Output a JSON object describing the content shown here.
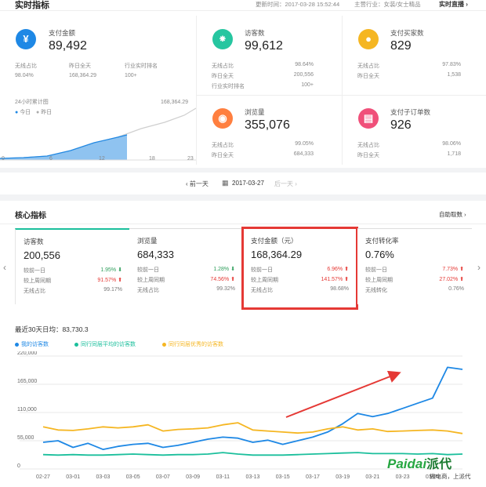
{
  "header": {
    "title": "实时指标",
    "updated": "更新时间：2017-03-28 15:52:44",
    "industry": "主营行业：女装/女士精品",
    "live_link": "实时直播"
  },
  "kpis": {
    "pay_amount": {
      "title": "支付金额",
      "value": "89,492",
      "labels": [
        "无线占比",
        "昨日全天",
        "行业实时排名"
      ],
      "values": [
        "98.04%",
        "168,364.29",
        "100+"
      ]
    },
    "visitors": {
      "title": "访客数",
      "value": "99,612",
      "labels": [
        "无线占比",
        "昨日全天",
        "行业实时排名"
      ],
      "values": [
        "98.64%",
        "200,556",
        "100+"
      ]
    },
    "buyers": {
      "title": "支付买家数",
      "value": "829",
      "labels": [
        "无线占比",
        "昨日全天"
      ],
      "values": [
        "97.83%",
        "1,538"
      ]
    },
    "pageviews": {
      "title": "浏览量",
      "value": "355,076",
      "labels": [
        "无线占比",
        "昨日全天"
      ],
      "values": [
        "99.05%",
        "684,333"
      ]
    },
    "sub_orders": {
      "title": "支付子订单数",
      "value": "926",
      "labels": [
        "无线占比",
        "昨日全天"
      ],
      "values": [
        "98.06%",
        "1,718"
      ]
    }
  },
  "mini_chart": {
    "title": "24小时累计图",
    "legend_today": "今日",
    "legend_yesterday": "昨日",
    "end_value": "168,364.29",
    "ticks": [
      "0",
      "6",
      "12",
      "18",
      "23"
    ]
  },
  "date_nav": {
    "prev": "前一天",
    "date": "2017-03-27",
    "next": "后一天"
  },
  "core": {
    "title": "核心指标",
    "auto_fetch": "自助取数",
    "cards": [
      {
        "title": "访客数",
        "value": "200,556",
        "rows": [
          {
            "label": "较前一日",
            "value": "1.95%",
            "dir": "down"
          },
          {
            "label": "较上周同期",
            "value": "91.57%",
            "dir": "up"
          },
          {
            "label": "无线占比",
            "value": "99.17%",
            "dir": ""
          }
        ]
      },
      {
        "title": "浏览量",
        "value": "684,333",
        "rows": [
          {
            "label": "较前一日",
            "value": "1.28%",
            "dir": "down"
          },
          {
            "label": "较上周同期",
            "value": "74.56%",
            "dir": "up"
          },
          {
            "label": "无线占比",
            "value": "99.32%",
            "dir": ""
          }
        ]
      },
      {
        "title": "支付金额（元）",
        "value": "168,364.29",
        "rows": [
          {
            "label": "较前一日",
            "value": "6.96%",
            "dir": "up"
          },
          {
            "label": "较上周同期",
            "value": "141.57%",
            "dir": "up"
          },
          {
            "label": "无线占比",
            "value": "98.68%",
            "dir": ""
          }
        ]
      },
      {
        "title": "支付转化率",
        "value": "0.76%",
        "rows": [
          {
            "label": "较前一日",
            "value": "7.73%",
            "dir": "up"
          },
          {
            "label": "较上周同期",
            "value": "27.02%",
            "dir": "up"
          },
          {
            "label": "无线转化",
            "value": "0.76%",
            "dir": ""
          }
        ]
      }
    ]
  },
  "trend": {
    "avg_text": "最近30天日均：83,730.3",
    "legend": [
      "我的访客数",
      "同行同层平均的访客数",
      "同行同层优秀的访客数"
    ]
  },
  "watermark": {
    "brand": "Paidai",
    "brand_cn": "派代",
    "tagline": "做电商，上派代"
  },
  "colors": {
    "mine": "#1e88e5",
    "avg": "#1bbf9c",
    "excellent": "#f5b622",
    "highlight": "#e53935"
  },
  "chart_data": {
    "type": "line",
    "x": [
      "02-27",
      "02-28",
      "03-01",
      "03-02",
      "03-03",
      "03-04",
      "03-05",
      "03-06",
      "03-07",
      "03-08",
      "03-09",
      "03-10",
      "03-11",
      "03-12",
      "03-13",
      "03-14",
      "03-15",
      "03-16",
      "03-17",
      "03-18",
      "03-19",
      "03-20",
      "03-21",
      "03-22",
      "03-23",
      "03-24",
      "03-25",
      "03-26",
      "03-27"
    ],
    "x_ticks": [
      "02-27",
      "03-01",
      "03-03",
      "03-05",
      "03-07",
      "03-09",
      "03-11",
      "03-13",
      "03-15",
      "03-17",
      "03-19",
      "03-21",
      "03-23",
      "03-25"
    ],
    "y_ticks": [
      "0",
      "55,000",
      "110,000",
      "165,000",
      "220,000"
    ],
    "ylim": [
      0,
      220000
    ],
    "series": [
      {
        "name": "我的访客数",
        "values": [
          52000,
          55000,
          42000,
          50000,
          38000,
          44000,
          48000,
          50000,
          42000,
          46000,
          52000,
          58000,
          62000,
          60000,
          52000,
          56000,
          48000,
          55000,
          62000,
          72000,
          88000,
          108000,
          102000,
          108000,
          118000,
          128000,
          138000,
          198000,
          194000
        ]
      },
      {
        "name": "同行同层平均的访客数",
        "values": [
          28000,
          27000,
          28000,
          27000,
          27000,
          28000,
          29000,
          28000,
          27000,
          28000,
          28000,
          29000,
          32000,
          29000,
          27000,
          27000,
          27000,
          28000,
          29000,
          30000,
          31000,
          32000,
          30000,
          30000,
          30000,
          29000,
          30000,
          28000,
          29000
        ]
      },
      {
        "name": "同行同层优秀的访客数",
        "values": [
          82000,
          76000,
          75000,
          78000,
          82000,
          80000,
          82000,
          86000,
          74000,
          77000,
          78000,
          80000,
          86000,
          90000,
          76000,
          74000,
          72000,
          70000,
          72000,
          78000,
          82000,
          76000,
          78000,
          73000,
          74000,
          75000,
          76000,
          74000,
          69000
        ]
      }
    ]
  }
}
